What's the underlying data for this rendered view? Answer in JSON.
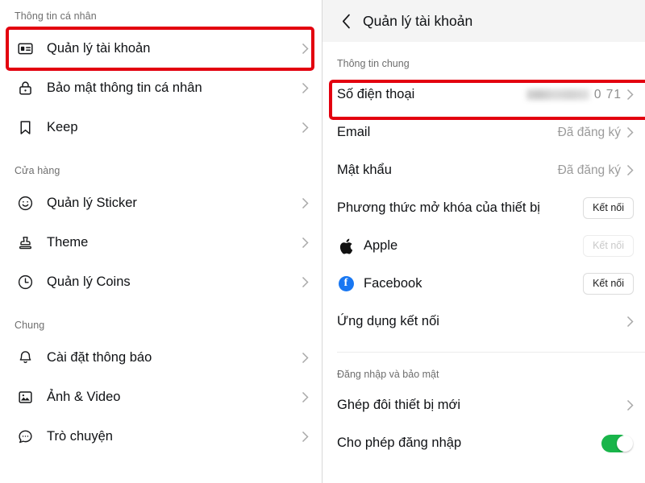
{
  "left_panel": {
    "sections": [
      {
        "label": "Thông tin cá nhân",
        "items": [
          {
            "label": "Quản lý tài khoản",
            "icon": "id-card-icon",
            "highlighted": true
          },
          {
            "label": "Bảo mật thông tin cá nhân",
            "icon": "lock-icon"
          },
          {
            "label": "Keep",
            "icon": "bookmark-icon"
          }
        ]
      },
      {
        "label": "Cửa hàng",
        "items": [
          {
            "label": "Quản lý Sticker",
            "icon": "smiley-icon"
          },
          {
            "label": "Theme",
            "icon": "stamp-icon"
          },
          {
            "label": "Quản lý Coins",
            "icon": "coin-clock-icon"
          }
        ]
      },
      {
        "label": "Chung",
        "items": [
          {
            "label": "Cài đặt thông báo",
            "icon": "bell-icon"
          },
          {
            "label": "Ảnh & Video",
            "icon": "image-icon"
          },
          {
            "label": "Trò chuyện",
            "icon": "chat-bubble-icon"
          }
        ]
      }
    ]
  },
  "right_panel": {
    "header": {
      "back_icon": "chevron-left-icon",
      "title": "Quản lý tài khoản"
    },
    "section_general": {
      "label": "Thông tin chung",
      "rows": [
        {
          "label": "Số điện thoại",
          "value_masked": true,
          "value_tail": "0 71",
          "control": "chevron",
          "highlighted": true
        },
        {
          "label": "Email",
          "value": "Đã đăng ký",
          "control": "chevron"
        },
        {
          "label": "Mật khẩu",
          "value": "Đã đăng ký",
          "control": "chevron"
        },
        {
          "label": "Phương thức mở khóa của thiết bị",
          "control": "button",
          "button_label": "Kết nối",
          "button_disabled": false
        },
        {
          "label": "Apple",
          "icon": "apple-icon",
          "control": "button",
          "button_label": "Kết nối",
          "button_disabled": true
        },
        {
          "label": "Facebook",
          "icon": "facebook-icon",
          "control": "button",
          "button_label": "Kết nối",
          "button_disabled": false
        },
        {
          "label": "Ứng dụng kết nối",
          "control": "chevron"
        }
      ]
    },
    "section_security": {
      "label": "Đăng nhập và bảo mật",
      "rows": [
        {
          "label": "Ghép đôi thiết bị mới",
          "control": "chevron"
        },
        {
          "label": "Cho phép đăng nhập",
          "control": "toggle",
          "toggle_on": true
        }
      ]
    }
  },
  "colors": {
    "highlight": "#e3000f",
    "toggle_on": "#19b54a",
    "facebook_blue": "#1877f2",
    "header_bg": "#f4f4f4",
    "muted_text": "#9b9b9b"
  }
}
